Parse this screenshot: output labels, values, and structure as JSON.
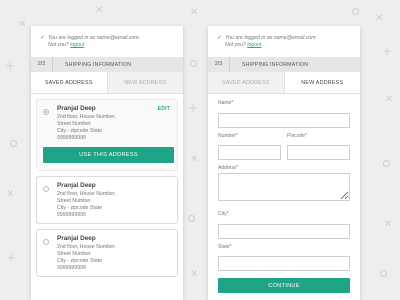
{
  "colors": {
    "accent": "#1fa487",
    "link": "#2aa889",
    "background": "#eeeeee"
  },
  "login": {
    "check_icon": "check-icon",
    "line1": "You are logged in as name@email.com.",
    "line2_prefix": "Not you?",
    "logout_label": "logout"
  },
  "shipping": {
    "step": "2/3",
    "title": "SHIPPING INFORMATION"
  },
  "tabs": {
    "saved": "SAVED ADDRESS",
    "new": "NEW ADDRESS"
  },
  "addresses": [
    {
      "name": "Pranjal Deep",
      "line1": "2nd floor, House Number,",
      "line2": "Street Number",
      "line3": "City - zipcode  State",
      "phone": "9999999999",
      "selected": true,
      "edit_label": "EDIT",
      "use_label": "USE THIS ADDRESS"
    },
    {
      "name": "Pranjal Deep",
      "line1": "2nd floor, House Number,",
      "line2": "Street Number",
      "line3": "City - zipcode  State",
      "phone": "9999999999",
      "selected": false
    },
    {
      "name": "Pranjal Deep",
      "line1": "2nd floor, House Number,",
      "line2": "Street Number",
      "line3": "City - zipcode  State",
      "phone": "9999999999",
      "selected": false
    }
  ],
  "form": {
    "name_label": "Name*",
    "number_label": "Number*",
    "pincode_label": "Pincode*",
    "address_label": "Address*",
    "city_label": "City*",
    "state_label": "State*",
    "name_value": "",
    "number_value": "",
    "pincode_value": "",
    "address_value": "",
    "city_value": "",
    "state_value": "",
    "continue_label": "CONTINUE"
  }
}
